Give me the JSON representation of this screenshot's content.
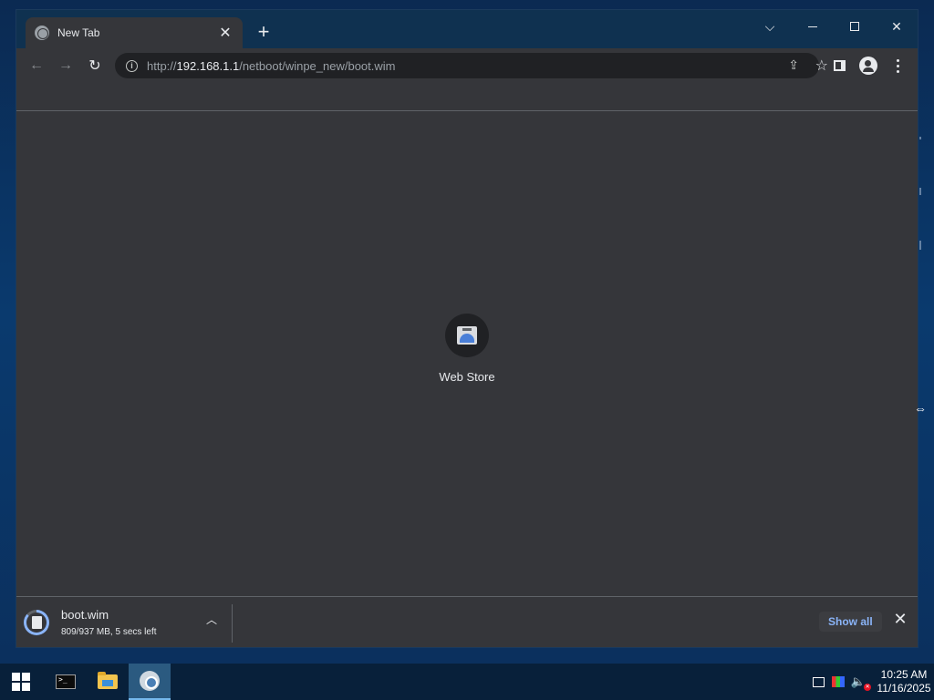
{
  "browser": {
    "tab": {
      "title": "New Tab",
      "close_glyph": "✕"
    },
    "new_tab_glyph": "+",
    "window_controls": {
      "tab_search": "⌵",
      "close": "✕"
    },
    "toolbar": {
      "back_glyph": "←",
      "forward_glyph": "→",
      "reload_glyph": "↻",
      "url_scheme": "http://",
      "url_host": "192.168.1.1",
      "url_path": "/netboot/winpe_new/boot.wim",
      "info_glyph": "i",
      "share_glyph": "⇪",
      "star_glyph": "☆"
    },
    "shortcut": {
      "label": "Web Store"
    },
    "download_shelf": {
      "file_name": "boot.wim",
      "status": "809/937 MB, 5 secs left",
      "progress_fraction": 0.864,
      "chevron_glyph": "︿",
      "show_all_label": "Show all",
      "close_glyph": "✕"
    }
  },
  "cursor_glyph": "⇔",
  "taskbar": {
    "volume_glyph": "🔈",
    "volume_badge": "✕",
    "clock": {
      "time": "10:25 AM",
      "date": "11/16/2025"
    }
  },
  "colors": {
    "page_bg": "#35363a",
    "omnibox_bg": "#202124",
    "accent_link": "#8ab4f8",
    "progress_ring": "#8ab4f8",
    "taskbar_bg": "#08203a"
  },
  "icons": [
    "globe-icon",
    "close-icon",
    "plus-icon",
    "chevron-down-icon",
    "minimize-icon",
    "maximize-icon",
    "back-arrow-icon",
    "forward-arrow-icon",
    "reload-icon",
    "info-icon",
    "share-icon",
    "star-icon",
    "side-panel-icon",
    "profile-icon",
    "menu-dots-icon",
    "web-store-icon",
    "file-icon",
    "chevron-up-icon",
    "windows-logo-icon",
    "terminal-icon",
    "folder-icon",
    "chrome-icon",
    "network-icon",
    "color-icon",
    "volume-muted-icon"
  ]
}
